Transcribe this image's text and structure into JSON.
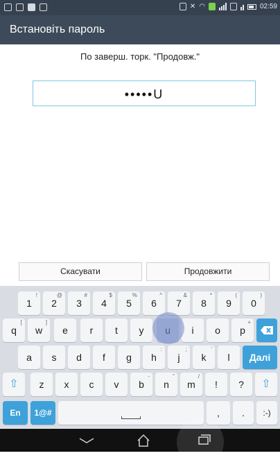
{
  "status_bar": {
    "time": "02:59",
    "icons": [
      "image-icon",
      "email-icon",
      "document-icon",
      "calendar-icon",
      "sim-icon",
      "mute-icon",
      "wifi-icon",
      "signal-icon",
      "nfc-icon",
      "battery-icon"
    ]
  },
  "header": {
    "title": "Встановіть пароль"
  },
  "instruction": "По заверш. торк. \"Продовж.\"",
  "password_field": {
    "value": "•••••U"
  },
  "actions": {
    "cancel_label": "Скасувати",
    "continue_label": "Продовжити"
  },
  "keyboard": {
    "row1": [
      {
        "k": "1",
        "alt": "!"
      },
      {
        "k": "2",
        "alt": "@"
      },
      {
        "k": "3",
        "alt": "#"
      },
      {
        "k": "4",
        "alt": "$"
      },
      {
        "k": "5",
        "alt": "%"
      },
      {
        "k": "6",
        "alt": "^"
      },
      {
        "k": "7",
        "alt": "&"
      },
      {
        "k": "8",
        "alt": "*"
      },
      {
        "k": "9",
        "alt": "("
      },
      {
        "k": "0",
        "alt": ")"
      }
    ],
    "row2": [
      {
        "k": "q",
        "alt": "["
      },
      {
        "k": "w",
        "alt": "]"
      },
      {
        "k": "e",
        "alt": ""
      },
      {
        "k": "r",
        "alt": ""
      },
      {
        "k": "t",
        "alt": ""
      },
      {
        "k": "y",
        "alt": ""
      },
      {
        "k": "u",
        "alt": ""
      },
      {
        "k": "i",
        "alt": ""
      },
      {
        "k": "o",
        "alt": ""
      },
      {
        "k": "p",
        "alt": "+"
      }
    ],
    "row3": [
      {
        "k": "a",
        "alt": ""
      },
      {
        "k": "s",
        "alt": ""
      },
      {
        "k": "d",
        "alt": ""
      },
      {
        "k": "f",
        "alt": ""
      },
      {
        "k": "g",
        "alt": ""
      },
      {
        "k": "h",
        "alt": ":"
      },
      {
        "k": "j",
        "alt": ";"
      },
      {
        "k": "k",
        "alt": "'"
      },
      {
        "k": "l",
        "alt": ""
      }
    ],
    "row4": [
      {
        "k": "z",
        "alt": ""
      },
      {
        "k": "x",
        "alt": ""
      },
      {
        "k": "c",
        "alt": ""
      },
      {
        "k": "v",
        "alt": ""
      },
      {
        "k": "b",
        "alt": "-"
      },
      {
        "k": "n",
        "alt": "\""
      },
      {
        "k": "m",
        "alt": "/"
      },
      {
        "k": "!",
        "alt": ""
      },
      {
        "k": "?",
        "alt": ""
      }
    ],
    "enter_label": "Далі",
    "lang_label": "En",
    "symbols_label": "1@#",
    "comma_label": ",",
    "period_label": ".",
    "smiley_label": ":-)",
    "pressed_key": "u"
  },
  "colors": {
    "accent": "#3ea1d9",
    "title_bar": "#3d4a5a",
    "status_bar": "#36414f"
  }
}
